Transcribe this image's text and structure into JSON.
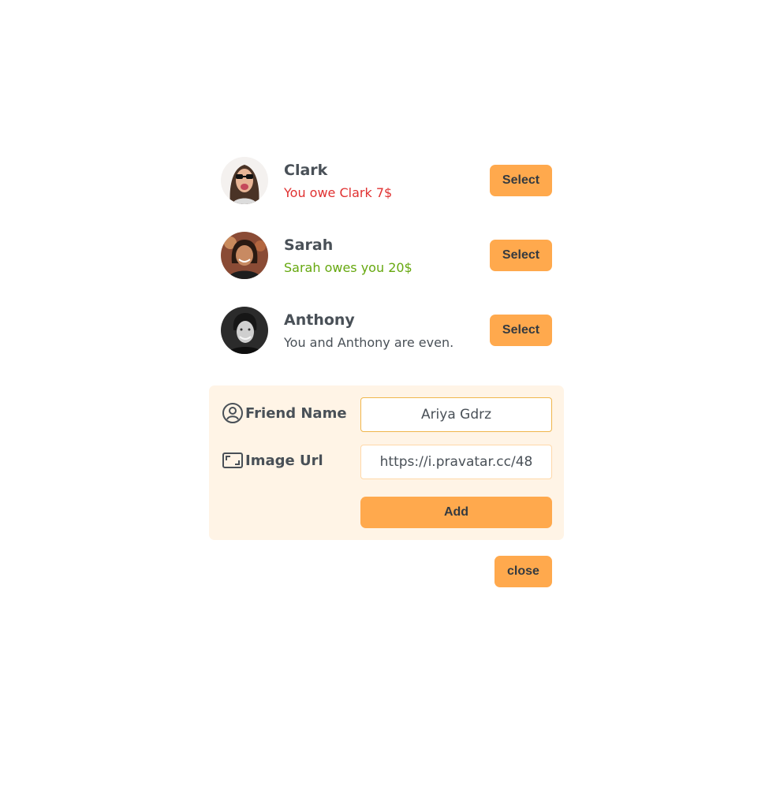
{
  "friends": [
    {
      "name": "Clark",
      "status": "You owe Clark 7$",
      "select_label": "Select"
    },
    {
      "name": "Sarah",
      "status": "Sarah owes you 20$",
      "select_label": "Select"
    },
    {
      "name": "Anthony",
      "status": "You and Anthony are even.",
      "select_label": "Select"
    }
  ],
  "form": {
    "friend_name_label": "Friend Name",
    "friend_name_value": "Ariya Gdrz",
    "image_url_label": "Image Url",
    "image_url_value": "https://i.pravatar.cc/48",
    "add_label": "Add",
    "friend_name_icon": "user-circle-icon",
    "image_url_icon": "image-frame-icon"
  },
  "close_label": "close",
  "colors": {
    "accent": "#ffa94d",
    "form_background": "#fff4e6",
    "owe_red": "#e03131",
    "owed_green": "#66a80f",
    "text": "#495057"
  }
}
